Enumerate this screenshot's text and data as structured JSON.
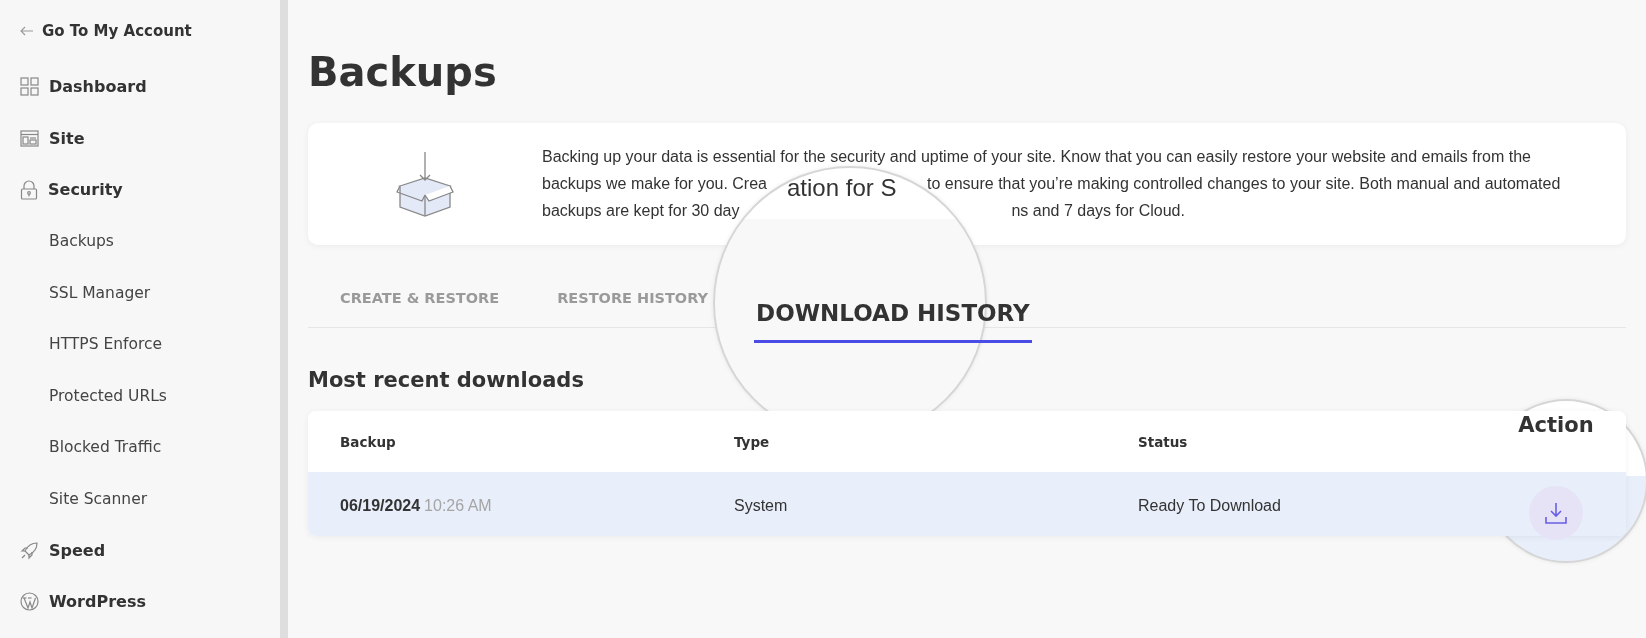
{
  "sidebar": {
    "back_link": "Go To My Account",
    "items": [
      {
        "kind": "section",
        "label": "Dashboard"
      },
      {
        "kind": "section",
        "label": "Site"
      },
      {
        "kind": "section",
        "label": "Security"
      },
      {
        "kind": "sub",
        "label": "Backups"
      },
      {
        "kind": "sub",
        "label": "SSL Manager"
      },
      {
        "kind": "sub",
        "label": "HTTPS Enforce"
      },
      {
        "kind": "sub",
        "label": "Protected URLs"
      },
      {
        "kind": "sub",
        "label": "Blocked Traffic"
      },
      {
        "kind": "sub",
        "label": "Site Scanner"
      },
      {
        "kind": "section",
        "label": "Speed"
      },
      {
        "kind": "section",
        "label": "WordPress"
      }
    ]
  },
  "page_title": "Backups",
  "intro": {
    "lines": [
      [
        "Backing up your data is essential for the security and uptime of your site. Know that you can easily restore your website and emails from the"
      ],
      [
        "backups we make for you. Crea",
        "to ensure that you’re making controlled changes to your site. Both manual and automated"
      ],
      [
        "backups are kept for 30 day",
        "ns and 7 days for Cloud."
      ]
    ],
    "magnified_text": "ation for S"
  },
  "tabs": [
    {
      "label": "CREATE & RESTORE",
      "selected": false
    },
    {
      "label": "RESTORE HISTORY",
      "selected": false
    },
    {
      "label": "DOWNLOAD HISTORY",
      "selected": true
    }
  ],
  "section_title": "Most recent downloads",
  "table": {
    "columns": [
      "Backup",
      "Type",
      "Status",
      "Action"
    ],
    "rows": [
      {
        "date": "06/19/2024",
        "time": "10:26 AM",
        "type": "System",
        "status": "Ready To Download"
      }
    ]
  }
}
